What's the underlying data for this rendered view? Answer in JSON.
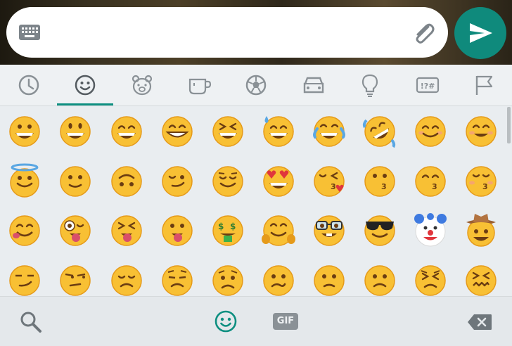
{
  "input": {
    "placeholder": ""
  },
  "tabs": [
    {
      "name": "recent",
      "icon": "clock-icon",
      "selected": false
    },
    {
      "name": "smileys",
      "icon": "smiley-icon",
      "selected": true
    },
    {
      "name": "animals",
      "icon": "bear-icon",
      "selected": false
    },
    {
      "name": "food",
      "icon": "cup-icon",
      "selected": false
    },
    {
      "name": "activities",
      "icon": "soccer-ball-icon",
      "selected": false
    },
    {
      "name": "travel",
      "icon": "car-icon",
      "selected": false
    },
    {
      "name": "objects",
      "icon": "lightbulb-icon",
      "selected": false
    },
    {
      "name": "symbols",
      "icon": "symbols-icon",
      "label": "!?#",
      "selected": false
    },
    {
      "name": "flags",
      "icon": "flag-icon",
      "selected": false
    }
  ],
  "emoji_rows": [
    [
      "grinning",
      "smiley",
      "smile",
      "grin",
      "laughing",
      "sweat-smile",
      "joy",
      "rofl",
      "blush-smile",
      "blush"
    ],
    [
      "innocent",
      "slight-smile",
      "upside-down",
      "wink-smile",
      "relieved",
      "heart-eyes",
      "kissing-heart",
      "kissing",
      "kissing-smiling-eyes",
      "kissing-closed-eyes"
    ],
    [
      "yum",
      "stuck-out-tongue-winking",
      "stuck-out-tongue-closed-eyes",
      "stuck-out-tongue",
      "money-mouth",
      "hugging",
      "nerd",
      "sunglasses",
      "clown",
      "cowboy"
    ],
    [
      "smirk",
      "unamused",
      "disappointed",
      "pensive",
      "worried",
      "confused",
      "slight-frown",
      "frowning",
      "persevere",
      "confounded"
    ]
  ],
  "bottom": {
    "gif_label": "GIF"
  },
  "colors": {
    "accent": "#0d8f80",
    "send": "#0f8a7c",
    "emoji_face": "#f8c034",
    "icon_gray": "#8a9196"
  }
}
